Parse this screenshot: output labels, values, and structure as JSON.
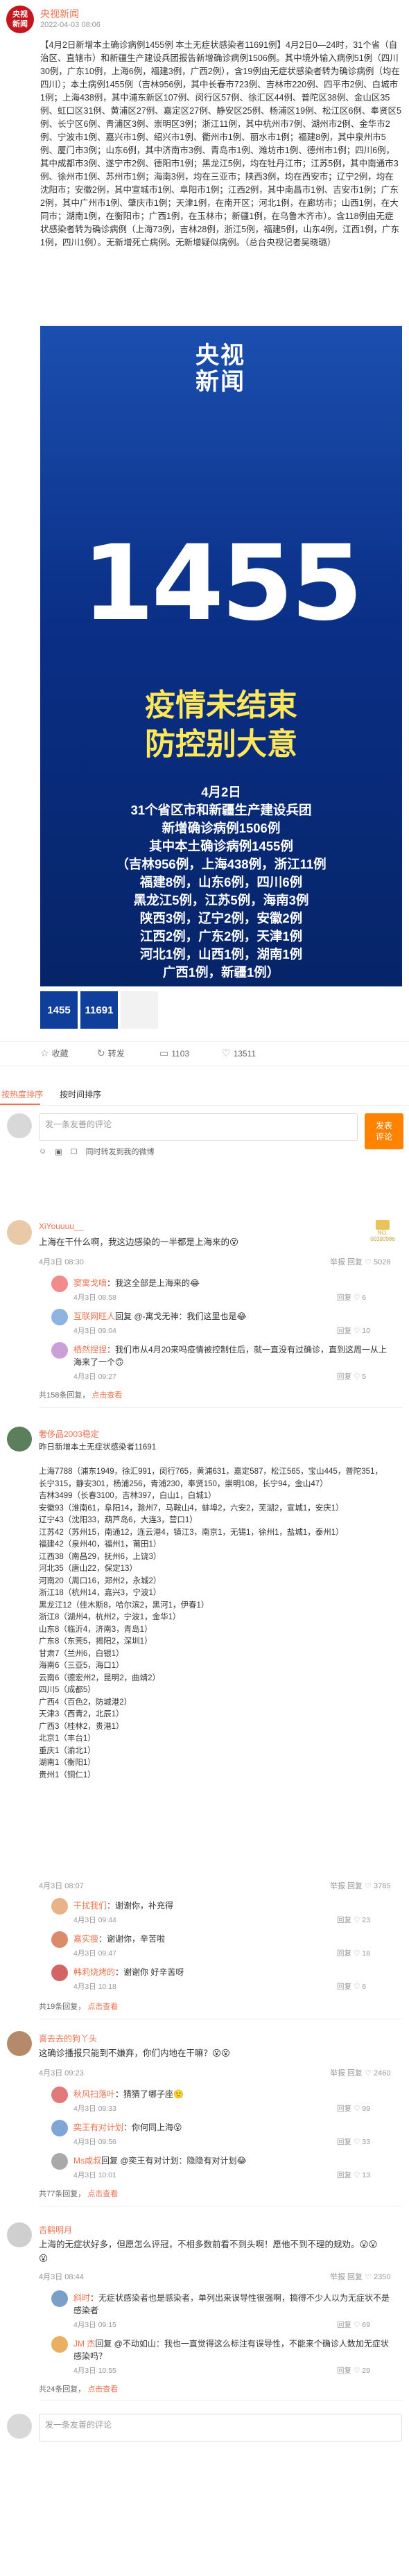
{
  "post": {
    "author": "央视新闻",
    "avatar_text": "央视\n新闻",
    "time": "2022-04-03 08:06",
    "text": "【4月2日新增本土确诊病例1455例 本土无症状感染者11691例】4月2日0—24时，31个省（自治区、直辖市）和新疆生产建设兵团报告新增确诊病例1506例。其中境外输入病例51例（四川30例，广东10例，上海6例，福建3例，广西2例），含19例由无症状感染者转为确诊病例（均在四川）；本土病例1455例（吉林956例，其中长春市723例、吉林市220例、四平市2例、白城市1例；上海438例，其中浦东新区107例、闵行区57例、徐汇区44例、普陀区38例、金山区35例、虹口区31例、黄浦区27例、嘉定区27例、静安区25例、杨浦区19例、松江区6例、奉贤区5例、长宁区6例、青浦区3例、崇明区3例；浙江11例，其中杭州市7例、湖州市2例、金华市2例、宁波市1例、嘉兴市1例、绍兴市1例、衢州市1例、丽水市1例；福建8例，其中泉州市5例、厦门市3例；山东6例，其中济南市3例、青岛市1例、潍坊市1例、德州市1例；四川6例，其中成都市3例、遂宁市2例、德阳市1例；黑龙江5例，均在牡丹江市；江苏5例，其中南通市3例、徐州市1例、苏州市1例；海南3例，均在三亚市；陕西3例，均在西安市；辽宁2例，均在沈阳市；安徽2例，其中宣城市1例、阜阳市1例；江西2例，其中南昌市1例、吉安市1例；广东2例，其中广州市1例、肇庆市1例；天津1例，在南开区；河北1例，在廊坊市；山西1例，在大同市；湖南1例，在衡阳市；广西1例，在玉林市；新疆1例，在乌鲁木齐市）。含118例由无症状感染者转为确诊病例（上海73例，吉林28例，浙江5例，福建5例，山东4例，江西1例，广东1例，四川1例）。无新增死亡病例。无新增疑似病例。（总台央视记者吴晓璐）",
    "poster": {
      "logo": "央视\n新闻",
      "number": "1455",
      "headline_1": "疫情未结束",
      "headline_2": "防控别大意",
      "detail": [
        "4月2日",
        "31个省区市和新疆生产建设兵团",
        "新增确诊病例1506例",
        "其中本土确诊病例1455例",
        "（吉林956例，上海438例，浙江11例",
        "福建8例，山东6例，四川6例",
        "黑龙江5例，江苏5例，海南3例",
        "陕西3例，辽宁2例，安徽2例",
        "江西2例，广东2例，天津1例",
        "河北1例，山西1例，湖南1例",
        "广西1例，新疆1例）"
      ]
    },
    "thumbs": [
      "1455",
      "11691",
      ""
    ]
  },
  "actions": {
    "favorite": "收藏",
    "repost": "转发",
    "comment_count": "1103",
    "like_count": "13511"
  },
  "tabs": {
    "hot": "按热度排序",
    "time": "按时间排序"
  },
  "composer": {
    "placeholder": "发一条友善的评论",
    "repost_check": "同时转发到我的微博",
    "send": "发表\n评论"
  },
  "comments": [
    {
      "name": "XiYouuuu__",
      "text": "上海在干什么啊，我这边感染的一半都是上海来的😮",
      "time": "4月3日 08:30",
      "actions": "举报  回复  ♡ 5028",
      "badge": "NO.\n00390986",
      "replies": [
        {
          "name": "窦寓戈嘀",
          "text": "：我这全部是上海来的😂",
          "time": "4月3日 08:58",
          "actions": "回复  ♡ 6"
        },
        {
          "name": "互联网旺人",
          "text": "回复 @-寓戈无神：我们这里也是😂",
          "time": "4月3日 09:04",
          "actions": "回复  ♡ 10"
        },
        {
          "name": "栖然捏捏",
          "text": "：我们市从4月20来吗疫情被控制住后，就一直没有过确诊，直到这周一从上海来了一个🙃",
          "time": "4月3日 09:27",
          "actions": "回复  ♡ 5"
        }
      ],
      "more": "共158条回复",
      "more_link": "点击查看"
    },
    {
      "name": "奢侈品2003稳定",
      "text": "昨日新增本土无症状感染者11691\n\n上海7788（浦东1949，徐汇991，闵行765，黄浦631，嘉定587，松江565，宝山445，普陀351，长宁315，静安301，杨浦256，青浦230，奉贤150，崇明108，长宁94，金山47）\n吉林3499（长春3100，吉林397，白山1，白城1）\n安徽93（淮南61，阜阳14，滁州7，马鞍山4，蚌埠2，六安2，芜湖2，宣城1，安庆1）\n辽宁43（沈阳33，葫芦岛6，大连3，营口1）\n江苏42（苏州15，南通12，连云港4，镇江3，南京1，无锡1，徐州1，盐城1，泰州1）\n福建42（泉州40，福州1，莆田1）\n江西38（南昌29，抚州6，上饶3）\n河北35（唐山22，保定13）\n河南20（周口16，郑州2，永城2）\n浙江18（杭州14，嘉兴3，宁波1）\n黑龙江12（佳木斯8，哈尔滨2，黑河1，伊春1）\n浙江8（湖州4，杭州2，宁波1，金华1）\n山东8（临沂4，济南3，青岛1）\n广东8（东莞5，揭阳2，深圳1）\n甘肃7（兰州6，白银1）\n海南6（三亚5，海口1）\n云南6（德宏州2，昆明2，曲靖2）\n四川5（成都5）\n广西4（百色2，防城港2）\n天津3（西青2，北辰1）\n广西3（桂林2，贵港1）\n北京1（丰台1）\n重庆1（渝北1）\n湖南1（衡阳1）\n贵州1（铜仁1）",
      "time": "4月3日 08:07",
      "actions": "举报  回复  ♡ 3785",
      "badge": "",
      "replies": [
        {
          "name": "干扰我们",
          "text": "：谢谢你，补充得",
          "time": "4月3日 09:44",
          "actions": "回复  ♡ 23"
        },
        {
          "name": "嘉实瘦",
          "text": "：谢谢你，辛苦啦",
          "time": "4月3日 09:47",
          "actions": "回复  ♡ 18"
        },
        {
          "name": "韩莉烧烤的",
          "text": "：谢谢你 好辛苦呀",
          "time": "4月3日 10:18",
          "actions": "回复  ♡ 6"
        }
      ],
      "more": "共19条回复",
      "more_link": "点击查看"
    },
    {
      "name": "喜去去的狗丫头",
      "text": "这确诊播报只能到不嫌弃，你们内地在干嘛？😮😮",
      "time": "4月3日 09:23",
      "actions": "举报  回复  ♡ 2460",
      "badge": "",
      "replies": [
        {
          "name": "秋风扫落叶",
          "text": "：猜猜了哪子座🙂",
          "time": "4月3日 09:33",
          "actions": "回复  ♡ 99"
        },
        {
          "name": "奕王有对计划",
          "text": "：你何同上海😮",
          "time": "4月3日 09:56",
          "actions": "回复  ♡ 33"
        },
        {
          "name": "Ms咸叔",
          "text": "回复 @奕王有对计划：隐隐有对计划😂",
          "time": "4月3日 10:01",
          "actions": "回复  ♡ 13"
        }
      ],
      "more": "共77条回复",
      "more_link": "点击查看"
    },
    {
      "name": "吉鹤明月",
      "text": "上海的无症状好多，但愿怎么评冠，不相多数前看不到头啊！愿他不到不理的规劝。😮😮😮",
      "time": "4月3日 08:44",
      "actions": "举报  回复  ♡ 2350",
      "badge": "",
      "replies": [
        {
          "name": "斜时",
          "text": "：无症状感染者也是感染者，单列出来误导性很强啊，搞得不少人以为无症状不是感染者",
          "time": "4月3日 09:15",
          "actions": "回复  ♡ 69"
        },
        {
          "name": "JM 杰",
          "text": "回复 @不动如山：我也一直觉得这么标注有误导性，不能来个确诊人数加无症状感染吗？",
          "time": "4月3日 10:55",
          "actions": "回复  ♡ 29"
        }
      ],
      "more": "共24条回复",
      "more_link": "点击查看"
    }
  ],
  "bottom_composer": {
    "placeholder": "发一条友善的评论"
  },
  "colors": {
    "accent": "#eb7350",
    "brand_red": "#c4161c",
    "poster_blue": "#0a2f86",
    "headline_yellow": "#ffe75a",
    "send_orange": "#ff8200"
  }
}
